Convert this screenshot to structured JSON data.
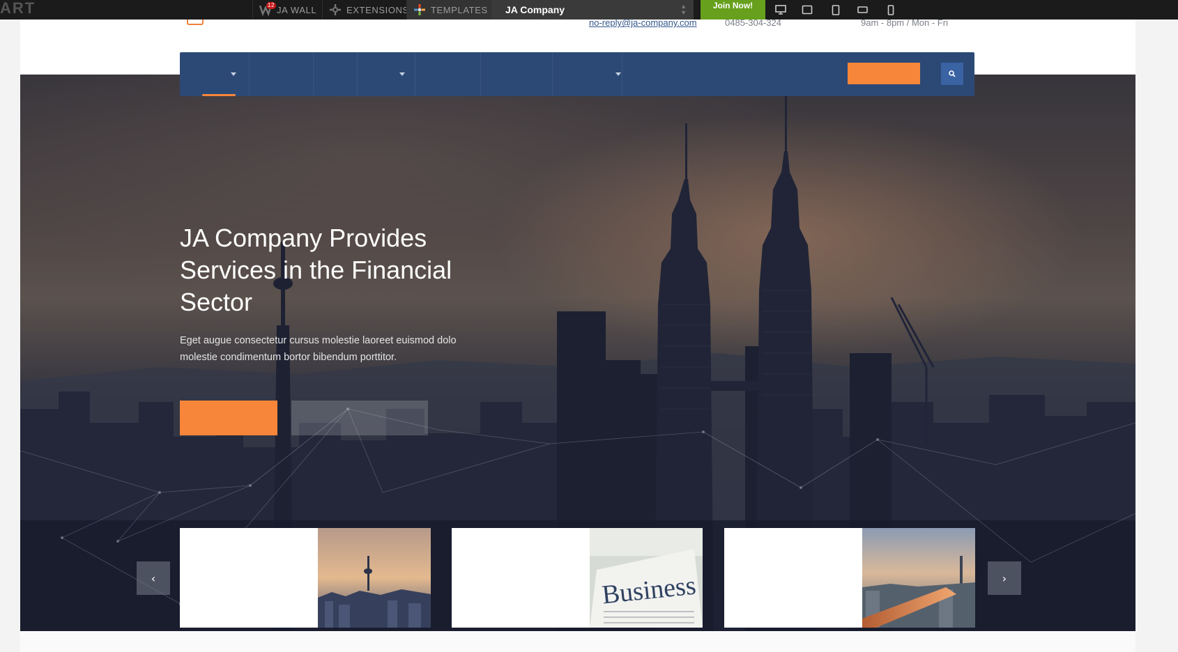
{
  "topbar": {
    "brand": "ART",
    "nav": [
      {
        "label": "JA WALL",
        "badge": "12"
      },
      {
        "label": "EXTENSIONS"
      },
      {
        "label": "TEMPLATES"
      }
    ],
    "template_select": "JA Company",
    "join_label": "Join Now!",
    "devices": [
      "desktop-icon",
      "tablet-landscape-icon",
      "tablet-portrait-icon",
      "mobile-landscape-icon",
      "mobile-portrait-icon"
    ]
  },
  "header": {
    "email": "no-reply@ja-company.com",
    "phone": "0485-304-324",
    "hours": "9am - 8pm / Mon - Fri"
  },
  "hero": {
    "title": "JA Company Provides Services in the Financial Sector",
    "text": "Eget augue consectetur cursus molestie laoreet euismod dolo molestie condimentum bortor bibendum porttitor."
  },
  "colors": {
    "accent": "#f8863a",
    "nav_bg": "#2c4976",
    "search_bg": "#3a63a3",
    "topbar_bg": "#1b1b1b",
    "join_bg": "#66a01c"
  },
  "icons": {
    "search": "search-icon",
    "prev": "chevron-left-icon",
    "next": "chevron-right-icon"
  },
  "slider": {
    "prev_glyph": "‹",
    "next_glyph": "›"
  }
}
